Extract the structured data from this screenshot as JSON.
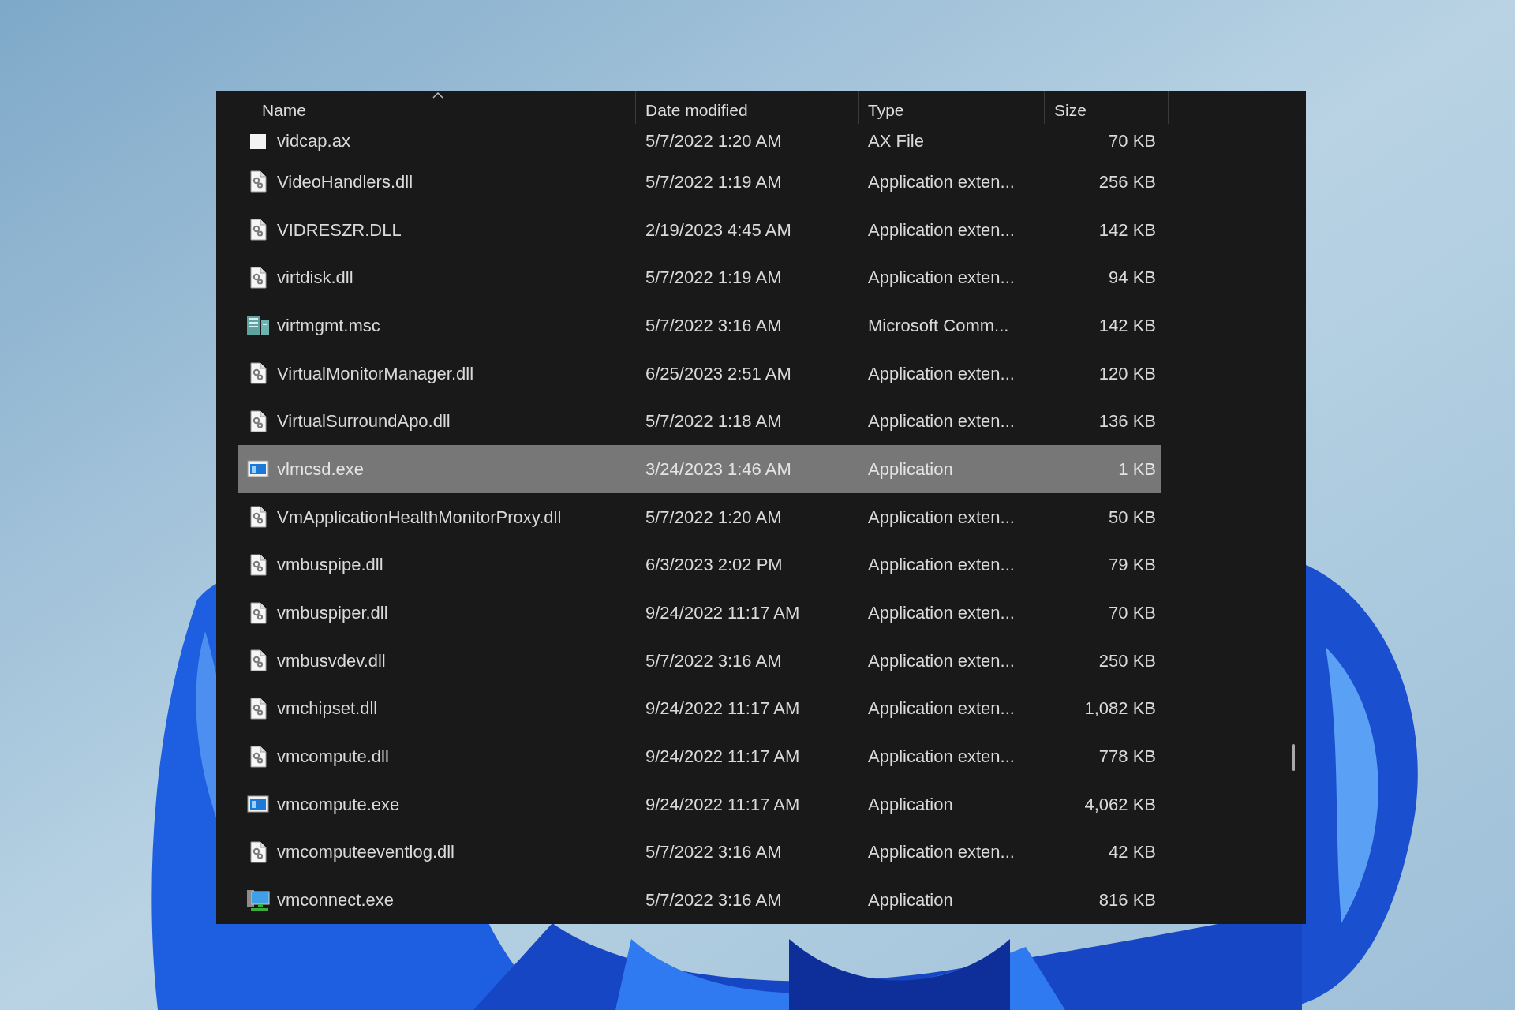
{
  "columns": [
    {
      "label": "Name",
      "sorted": true
    },
    {
      "label": "Date modified",
      "sorted": false
    },
    {
      "label": "Type",
      "sorted": false
    },
    {
      "label": "Size",
      "sorted": false
    }
  ],
  "rows": [
    {
      "kind": "plain",
      "name": "vidcap.ax",
      "date": "5/7/2022 1:20 AM",
      "type": "AX File",
      "size": "70 KB",
      "selected": false
    },
    {
      "kind": "library",
      "name": "VideoHandlers.dll",
      "date": "5/7/2022 1:19 AM",
      "type": "Application exten...",
      "size": "256 KB",
      "selected": false
    },
    {
      "kind": "library",
      "name": "VIDRESZR.DLL",
      "date": "2/19/2023 4:45 AM",
      "type": "Application exten...",
      "size": "142 KB",
      "selected": false
    },
    {
      "kind": "library",
      "name": "virtdisk.dll",
      "date": "5/7/2022 1:19 AM",
      "type": "Application exten...",
      "size": "94 KB",
      "selected": false
    },
    {
      "kind": "console",
      "name": "virtmgmt.msc",
      "date": "5/7/2022 3:16 AM",
      "type": "Microsoft Comm...",
      "size": "142 KB",
      "selected": false
    },
    {
      "kind": "library",
      "name": "VirtualMonitorManager.dll",
      "date": "6/25/2023 2:51 AM",
      "type": "Application exten...",
      "size": "120 KB",
      "selected": false
    },
    {
      "kind": "library",
      "name": "VirtualSurroundApo.dll",
      "date": "5/7/2022 1:18 AM",
      "type": "Application exten...",
      "size": "136 KB",
      "selected": false
    },
    {
      "kind": "application",
      "name": "vlmcsd.exe",
      "date": "3/24/2023 1:46 AM",
      "type": "Application",
      "size": "1 KB",
      "selected": true
    },
    {
      "kind": "library",
      "name": "VmApplicationHealthMonitorProxy.dll",
      "date": "5/7/2022 1:20 AM",
      "type": "Application exten...",
      "size": "50 KB",
      "selected": false
    },
    {
      "kind": "library",
      "name": "vmbuspipe.dll",
      "date": "6/3/2023 2:02 PM",
      "type": "Application exten...",
      "size": "79 KB",
      "selected": false
    },
    {
      "kind": "library",
      "name": "vmbuspiper.dll",
      "date": "9/24/2022 11:17 AM",
      "type": "Application exten...",
      "size": "70 KB",
      "selected": false
    },
    {
      "kind": "library",
      "name": "vmbusvdev.dll",
      "date": "5/7/2022 3:16 AM",
      "type": "Application exten...",
      "size": "250 KB",
      "selected": false
    },
    {
      "kind": "library",
      "name": "vmchipset.dll",
      "date": "9/24/2022 11:17 AM",
      "type": "Application exten...",
      "size": "1,082 KB",
      "selected": false
    },
    {
      "kind": "library",
      "name": "vmcompute.dll",
      "date": "9/24/2022 11:17 AM",
      "type": "Application exten...",
      "size": "778 KB",
      "selected": false
    },
    {
      "kind": "application",
      "name": "vmcompute.exe",
      "date": "9/24/2022 11:17 AM",
      "type": "Application",
      "size": "4,062 KB",
      "selected": false
    },
    {
      "kind": "library",
      "name": "vmcomputeeventlog.dll",
      "date": "5/7/2022 3:16 AM",
      "type": "Application exten...",
      "size": "42 KB",
      "selected": false
    },
    {
      "kind": "remote",
      "name": "vmconnect.exe",
      "date": "5/7/2022 3:16 AM",
      "type": "Application",
      "size": "816 KB",
      "selected": false
    }
  ]
}
